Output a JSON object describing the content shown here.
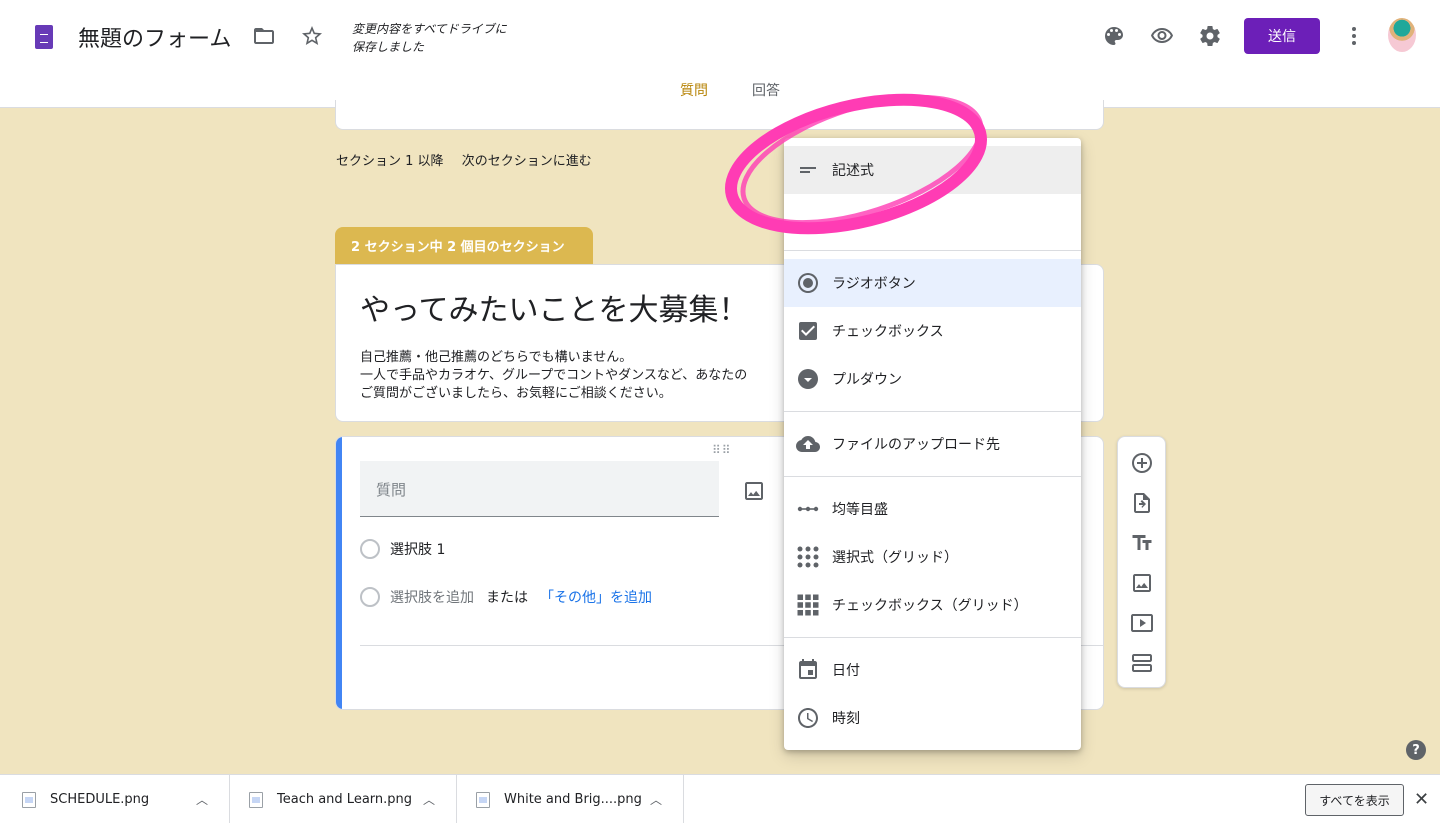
{
  "header": {
    "form_title": "無題のフォーム",
    "save_status_line1": "変更内容をすべてドライブに",
    "save_status_line2": "保存しました",
    "send_label": "送信",
    "icons": [
      "folder-icon",
      "star-icon",
      "palette-icon",
      "preview-eye-icon",
      "settings-gear-icon",
      "more-vert-icon"
    ],
    "tabs": [
      {
        "label": "質問",
        "active": true
      },
      {
        "label": "回答",
        "active": false
      }
    ],
    "accent_color": "#6c1fb8"
  },
  "after_section": {
    "label": "セクション 1 以降",
    "action": "次のセクションに進む"
  },
  "section": {
    "tab_label": "2 セクション中 2 個目のセクション",
    "title": "やってみたいことを大募集！",
    "desc_line1": "自己推薦・他己推薦のどちらでも構いません。",
    "desc_line2": "一人で手品やカラオケ、グループでコントやダンスなど、あなたの",
    "desc_line3": "ご質問がございましたら、お気軽にご相談ください。",
    "tab_color": "#dcb850"
  },
  "question": {
    "placeholder": "質問",
    "option1": "選択肢 1",
    "add_option": "選択肢を追加",
    "or": "または",
    "add_other": "「その他」を追加"
  },
  "type_menu": {
    "items": [
      {
        "label": "記述式",
        "icon": "paragraph-lines-icon",
        "state": "hover"
      },
      {
        "label": "ラジオボタン",
        "icon": "radio-button-icon",
        "state": "selected"
      },
      {
        "label": "チェックボックス",
        "icon": "checkbox-icon",
        "state": ""
      },
      {
        "label": "プルダウン",
        "icon": "dropdown-arrow-icon",
        "state": ""
      },
      {
        "label": "ファイルのアップロード先",
        "icon": "cloud-upload-icon",
        "state": ""
      },
      {
        "label": "均等目盛",
        "icon": "linear-scale-icon",
        "state": ""
      },
      {
        "label": "選択式（グリッド）",
        "icon": "dot-grid-icon",
        "state": ""
      },
      {
        "label": "チェックボックス（グリッド）",
        "icon": "square-grid-icon",
        "state": ""
      },
      {
        "label": "日付",
        "icon": "calendar-icon",
        "state": ""
      },
      {
        "label": "時刻",
        "icon": "clock-icon",
        "state": ""
      }
    ]
  },
  "side_toolbar": {
    "icons": [
      "add-question-icon",
      "import-questions-icon",
      "add-title-icon",
      "add-image-icon",
      "add-video-icon",
      "add-section-icon"
    ]
  },
  "annotation_color": "#ff3cb4",
  "help_label": "?",
  "downloads": {
    "files": [
      {
        "name": "SCHEDULE.png"
      },
      {
        "name": "Teach and Learn.png"
      },
      {
        "name": "White and Brig....png"
      }
    ],
    "show_all": "すべてを表示",
    "close": "✕"
  }
}
